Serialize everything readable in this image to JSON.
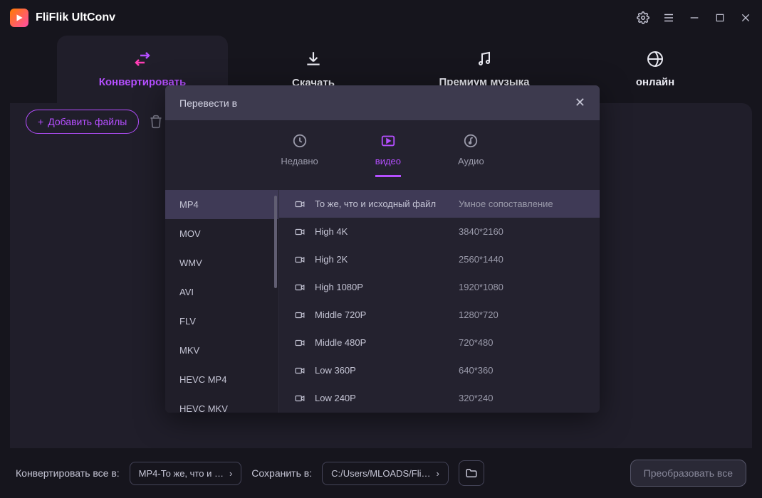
{
  "app": {
    "title": "FliFlik UltConv"
  },
  "nav": {
    "convert": "Конвертировать",
    "download": "Скачать",
    "music": "Премиум музыка",
    "online": "онлайн"
  },
  "toolbar": {
    "add_files": "Добавить файлы"
  },
  "modal": {
    "title": "Перевести в",
    "tab_recent": "Недавно",
    "tab_video": "видео",
    "tab_audio": "Аудио",
    "formats": [
      "MP4",
      "MOV",
      "WMV",
      "AVI",
      "FLV",
      "MKV",
      "HEVC MP4",
      "HEVC MKV"
    ],
    "qualities": [
      {
        "label": "То же, что и исходный файл",
        "res": "Умное сопоставление"
      },
      {
        "label": "High 4K",
        "res": "3840*2160"
      },
      {
        "label": "High 2K",
        "res": "2560*1440"
      },
      {
        "label": "High 1080P",
        "res": "1920*1080"
      },
      {
        "label": "Middle 720P",
        "res": "1280*720"
      },
      {
        "label": "Middle 480P",
        "res": "720*480"
      },
      {
        "label": "Low 360P",
        "res": "640*360"
      },
      {
        "label": "Low 240P",
        "res": "320*240"
      }
    ]
  },
  "footer": {
    "convert_all": "Конвертировать все в:",
    "format_value": "MP4-То же, что и …",
    "save_to": "Сохранить в:",
    "path_value": "C:/Users/MLOADS/Fli…",
    "convert_btn": "Преобразовать все"
  }
}
